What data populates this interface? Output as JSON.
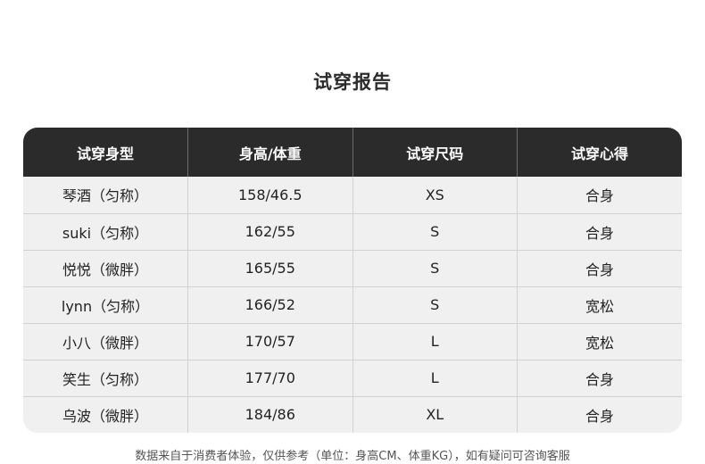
{
  "title": "试穿报告",
  "table": {
    "headers": [
      "试穿身型",
      "身高/体重",
      "试穿尺码",
      "试穿心得"
    ],
    "rows": [
      [
        "琴酒（匀称）",
        "158/46.5",
        "XS",
        "合身"
      ],
      [
        "suki（匀称）",
        "162/55",
        "S",
        "合身"
      ],
      [
        "悦悦（微胖）",
        "165/55",
        "S",
        "合身"
      ],
      [
        "lynn（匀称）",
        "166/52",
        "S",
        "宽松"
      ],
      [
        "小八（微胖）",
        "170/57",
        "L",
        "宽松"
      ],
      [
        "笑生（匀称）",
        "177/70",
        "L",
        "合身"
      ],
      [
        "乌波（微胖）",
        "184/86",
        "XL",
        "合身"
      ]
    ]
  },
  "footnote": "数据来自于消费者体验，仅供参考（单位：身高CM、体重KG），如有疑问可咨询客服",
  "colors": {
    "header_bg": "#2b2b2b",
    "header_text": "#ffffff",
    "body_bg": "#f0f0f0",
    "grid": "#d2d2d2"
  }
}
